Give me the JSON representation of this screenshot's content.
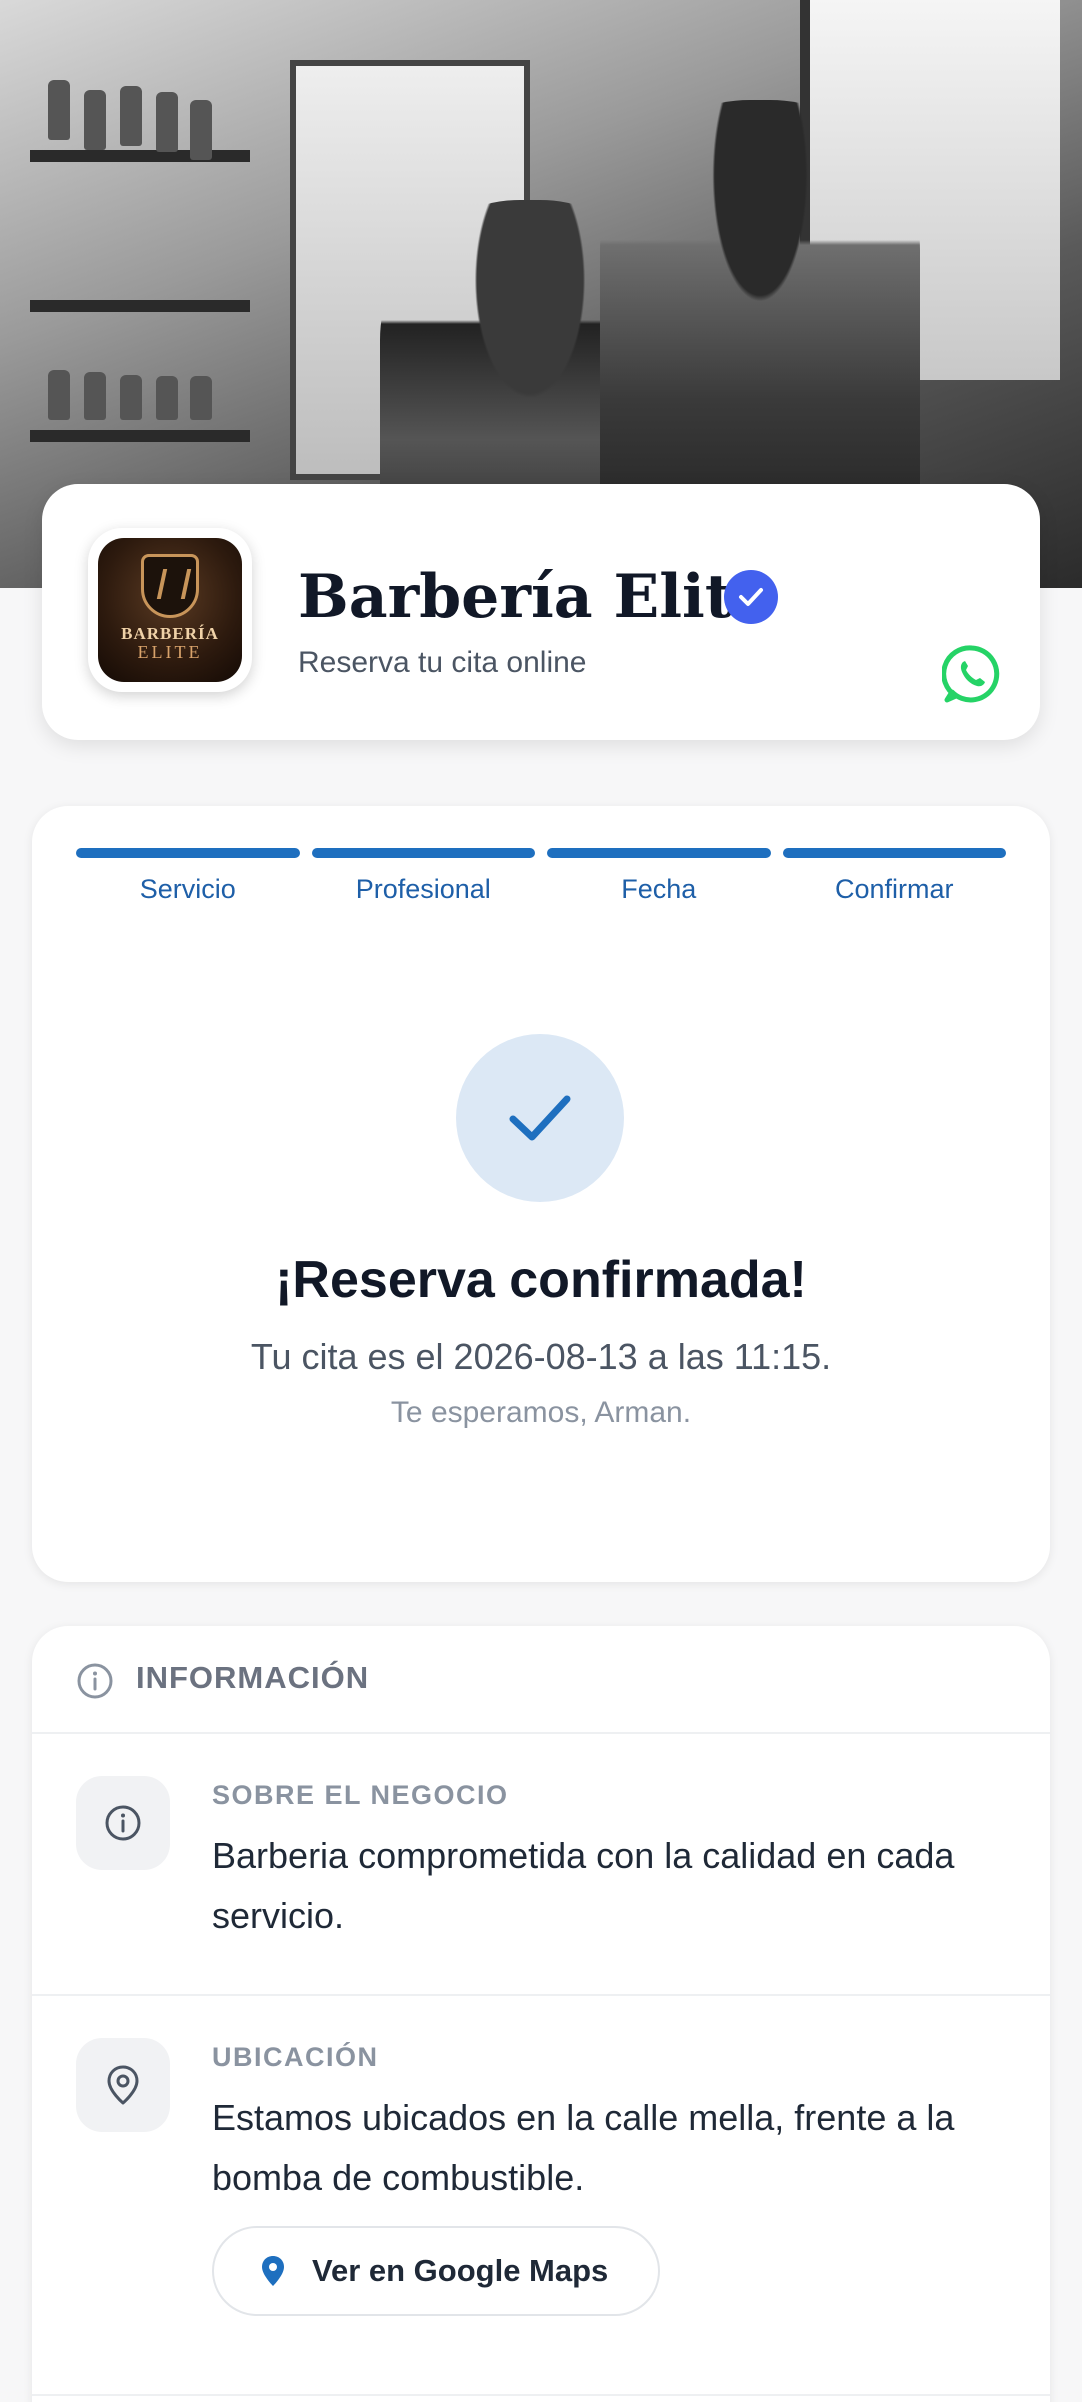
{
  "header": {
    "business_name": "Barbería Elite",
    "subtitle": "Reserva tu cita online",
    "logo_line1": "BARBERÍA",
    "logo_line2": "ELITE"
  },
  "steps": [
    {
      "label": "Servicio",
      "complete": true
    },
    {
      "label": "Profesional",
      "complete": true
    },
    {
      "label": "Fecha",
      "complete": true
    },
    {
      "label": "Confirmar",
      "complete": true
    }
  ],
  "confirmation": {
    "title": "¡Reserva confirmada!",
    "detail": "Tu cita es el 2026-08-13 a las 11:15.",
    "greeting": "Te esperamos, Arman."
  },
  "info": {
    "title": "INFORMACIÓN",
    "about_label": "SOBRE EL NEGOCIO",
    "about_text": "Barberia comprometida con la calidad en cada servicio.",
    "location_label": "UBICACIÓN",
    "location_text": "Estamos ubicados en la calle mella, frente a la bomba de combustible.",
    "maps_button": "Ver en Google Maps"
  },
  "colors": {
    "accent": "#1e6fbf",
    "verified": "#4361ee",
    "whatsapp": "#25d366"
  },
  "icons": [
    "verified-badge-icon",
    "whatsapp-icon",
    "check-icon",
    "info-icon",
    "location-pin-icon",
    "map-pin-icon"
  ]
}
